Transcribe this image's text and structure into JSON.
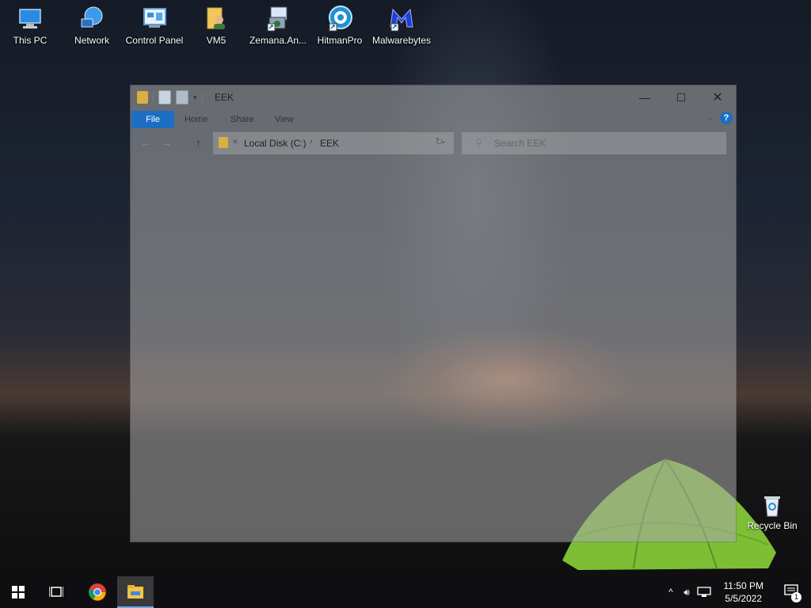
{
  "desktop": {
    "icons": [
      {
        "label": "This PC",
        "icon": "computer-icon"
      },
      {
        "label": "Network",
        "icon": "network-icon"
      },
      {
        "label": "Control Panel",
        "icon": "control-panel-icon"
      },
      {
        "label": "VM5",
        "icon": "user-folder-icon"
      },
      {
        "label": "Zemana.An...",
        "icon": "installer-shortcut-icon"
      },
      {
        "label": "HitmanPro",
        "icon": "hitmanpro-icon"
      },
      {
        "label": "Malwarebytes",
        "icon": "malwarebytes-icon"
      }
    ],
    "recycle_bin": {
      "label": "Recycle Bin",
      "icon": "recycle-bin-icon"
    }
  },
  "explorer": {
    "title": "EEK",
    "tabs": {
      "file": "File",
      "home": "Home",
      "share": "Share",
      "view": "View"
    },
    "address": {
      "root_marker": "«",
      "crumb1": "Local Disk (C:)",
      "separator": "›",
      "crumb2": "EEK"
    },
    "search": {
      "placeholder": "Search EEK"
    },
    "help_label": "?"
  },
  "taskbar": {
    "clock_time": "11:50 PM",
    "clock_date": "5/5/2022",
    "notification_count": "1",
    "apps": [
      {
        "name": "Start",
        "icon": "windows-logo-icon"
      },
      {
        "name": "Task View",
        "icon": "task-view-icon"
      },
      {
        "name": "Google Chrome",
        "icon": "chrome-icon"
      },
      {
        "name": "File Explorer",
        "icon": "file-explorer-icon",
        "active": true
      }
    ]
  },
  "colors": {
    "accent": "#1c6ec2",
    "taskbar": "#0f0f11"
  }
}
